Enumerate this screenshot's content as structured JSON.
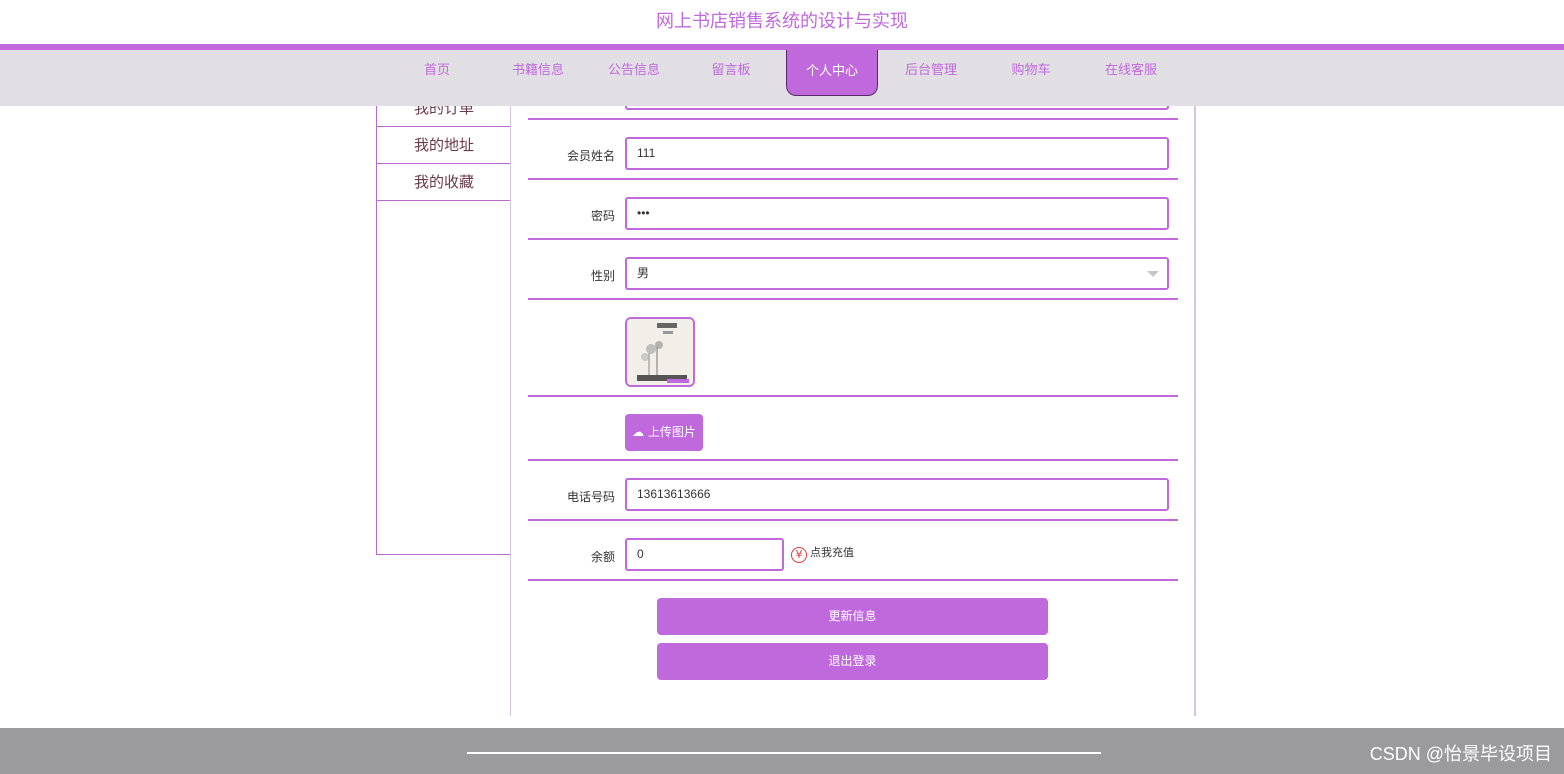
{
  "site": {
    "title": "网上书店销售系统的设计与实现"
  },
  "nav": {
    "items": [
      {
        "label": "首页"
      },
      {
        "label": "书籍信息"
      },
      {
        "label": "公告信息"
      },
      {
        "label": "留言板"
      },
      {
        "label": "个人中心",
        "active": true
      },
      {
        "label": "后台管理"
      },
      {
        "label": "购物车"
      },
      {
        "label": "在线客服"
      }
    ]
  },
  "sidebar": {
    "items": [
      {
        "label": "我的订单"
      },
      {
        "label": "我的地址"
      },
      {
        "label": "我的收藏"
      }
    ]
  },
  "form": {
    "name": {
      "label": "会员姓名",
      "value": "111"
    },
    "password": {
      "label": "密码",
      "value": "•••"
    },
    "gender": {
      "label": "性别",
      "value": "男"
    },
    "upload_label": "上传图片",
    "phone": {
      "label": "电话号码",
      "value": "13613613666"
    },
    "balance": {
      "label": "余额",
      "value": "0",
      "recharge_label": "点我充值",
      "currency_symbol": "¥"
    },
    "update_button": "更新信息",
    "logout_button": "退出登录"
  },
  "footer": {
    "watermark": "CSDN @怡景毕设项目"
  },
  "colors": {
    "accent": "#c069dd",
    "nav_bg": "#e1dfe3",
    "footer_bg": "#9b9a9c"
  }
}
